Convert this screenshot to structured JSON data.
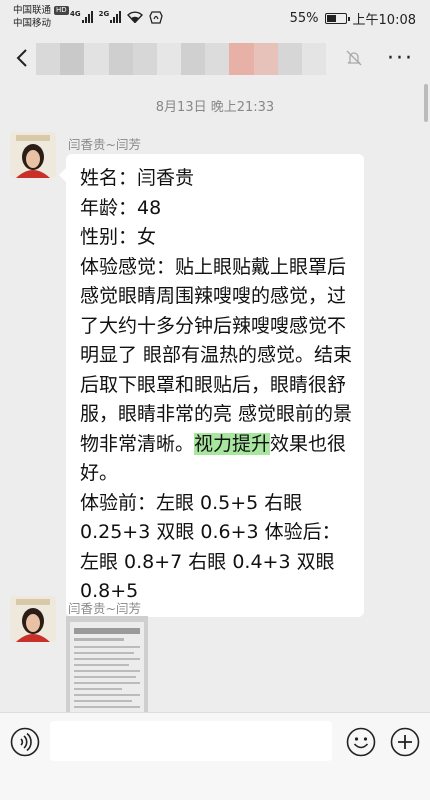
{
  "status": {
    "carrier1": "中国联通",
    "hd": "HD",
    "carrier2": "中国移动",
    "net1": "4G",
    "net2": "2G",
    "battery": "55%",
    "battery_level": 0.55,
    "time": "上午10:08"
  },
  "header": {
    "title_blur_colors": [
      "#d9d9d9",
      "#c9c9c9",
      "#e2e2e2",
      "#cfcfcf",
      "#d7d7d7",
      "#e6e6e6",
      "#d0d0d0",
      "#dcdcdc",
      "#e8b1a8",
      "#e7c2bb",
      "#d6d6d6",
      "#e4e4e4"
    ]
  },
  "chat": {
    "timestamp": "8月13日 晚上21:33",
    "messages": [
      {
        "sender": "闫香贵~闫芳",
        "lines": [
          "姓名：闫香贵",
          "年龄：48",
          "性别：女"
        ],
        "para1": "体验感觉：贴上眼贴戴上眼罩后感觉眼睛周围辣嗖嗖的感觉，过了大约十多分钟后辣嗖嗖感觉不明显了 眼部有温热的感觉。结束后取下眼罩和眼贴后，眼睛很舒服，眼睛非常的亮 感觉眼前的景物非常清晰。",
        "highlight": "视力提升",
        "para1_end": "效果也很好。",
        "para2": "体验前：左眼 0.5+5 右眼 0.25+3 双眼 0.6+3 体验后：左眼 0.8+7 右眼 0.4+3 双眼 0.8+5"
      },
      {
        "sender": "闫香贵~闫芳",
        "type": "image"
      }
    ]
  }
}
